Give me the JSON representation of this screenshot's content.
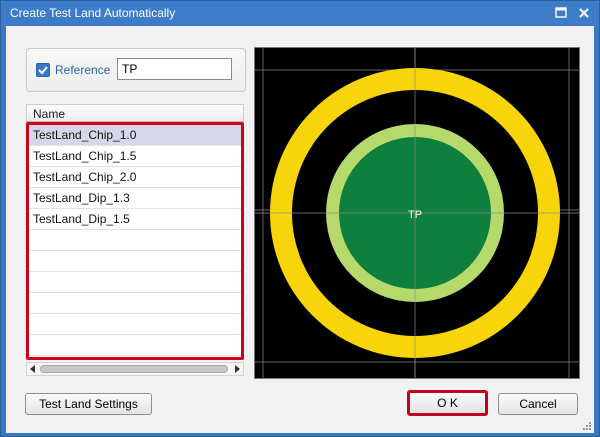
{
  "window": {
    "title": "Create Test Land Automatically"
  },
  "reference": {
    "checked": true,
    "label": "Reference",
    "value": "TP"
  },
  "list": {
    "header": "Name",
    "items": [
      "TestLand_Chip_1.0",
      "TestLand_Chip_1.5",
      "TestLand_Chip_2.0",
      "TestLand_Dip_1.3",
      "TestLand_Dip_1.5"
    ],
    "selected_index": 0,
    "empty_rows": 6
  },
  "preview": {
    "label": "TP",
    "colors": {
      "background": "#000000",
      "outer_ring": "#f7d50a",
      "inner_ring": "#b5d96b",
      "pad": "#0e7f3c",
      "grid": "#8a8a8a"
    }
  },
  "buttons": {
    "settings": "Test Land Settings",
    "ok": "O K",
    "cancel": "Cancel"
  },
  "colors": {
    "titlebar": "#3d7cc9",
    "highlight_border": "#d0021b",
    "selected_row": "#d7d7ea"
  },
  "icons": {
    "maximize": "maximize-icon",
    "close": "close-icon",
    "checkbox": "checkmark-icon",
    "scroll_left": "chevron-left-icon",
    "scroll_right": "chevron-right-icon",
    "resize": "resize-grip-icon"
  }
}
